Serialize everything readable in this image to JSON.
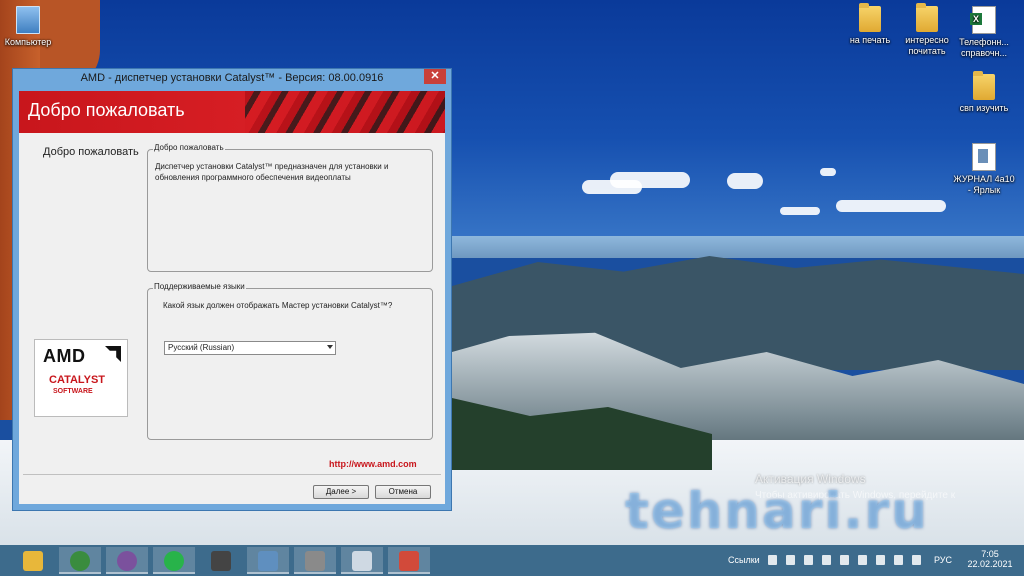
{
  "desktop": {
    "icons_left": [
      {
        "label": "Компьютер",
        "icon": "computer-icon"
      }
    ],
    "icons_right": [
      {
        "label": "на печать",
        "icon": "folder-icon"
      },
      {
        "label": "интересно почитать",
        "icon": "folder-icon"
      },
      {
        "label": "Телефонн... справочн...",
        "icon": "excel-icon"
      },
      {
        "label": "свп изучить",
        "icon": "folder-icon"
      },
      {
        "label": "ЖУРНАЛ 4а10 - Ярлык",
        "icon": "shortcut-icon"
      }
    ]
  },
  "window": {
    "title": "AMD - диспетчер установки Catalyst™ - Версия: 08.00.0916",
    "close_glyph": "✕",
    "banner_title": "Добро пожаловать",
    "sidebar_step": "Добро пожаловать",
    "logo": {
      "brand": "AMD",
      "product": "CATALYST",
      "sub": "SOFTWARE"
    },
    "welcome_group": {
      "legend": "Добро пожаловать",
      "text": "Диспетчер установки Catalyst™ предназначен для установки и обновления программного обеспечения видеоплаты"
    },
    "languages_group": {
      "legend": "Поддерживаемые языки",
      "question": "Какой язык должен отображать Мастер установки Catalyst™?",
      "selected_language": "Русский (Russian)"
    },
    "link": "http://www.amd.com",
    "buttons": {
      "next": "Далее >",
      "cancel": "Отмена"
    }
  },
  "watermark": {
    "activation_title": "Активация Windows",
    "activation_text": "Чтобы активировать Windows, перейдите к",
    "site": "tehnari.ru"
  },
  "taskbar": {
    "apps": [
      {
        "name": "file-explorer-icon",
        "color": "#e8b73a"
      },
      {
        "name": "chrome-icon",
        "color": "#3a8c3e"
      },
      {
        "name": "viber-icon",
        "color": "#7b519d"
      },
      {
        "name": "whatsapp-icon",
        "color": "#28b34a"
      },
      {
        "name": "media-player-icon",
        "color": "#444444"
      },
      {
        "name": "network-app-icon",
        "color": "#5f8fbf"
      },
      {
        "name": "installer-icon",
        "color": "#8a8a8a"
      },
      {
        "name": "control-panel-icon",
        "color": "#cfd9e3"
      },
      {
        "name": "amd-catalyst-icon",
        "color": "#d24a3a"
      }
    ],
    "links_label": "Ссылки",
    "language": "РУС",
    "time": "7:05",
    "date": "22.02.2021"
  },
  "colors": {
    "amd_red": "#c8161c",
    "window_frame": "#6fa8dc",
    "taskbar": "#3d6b8c"
  }
}
